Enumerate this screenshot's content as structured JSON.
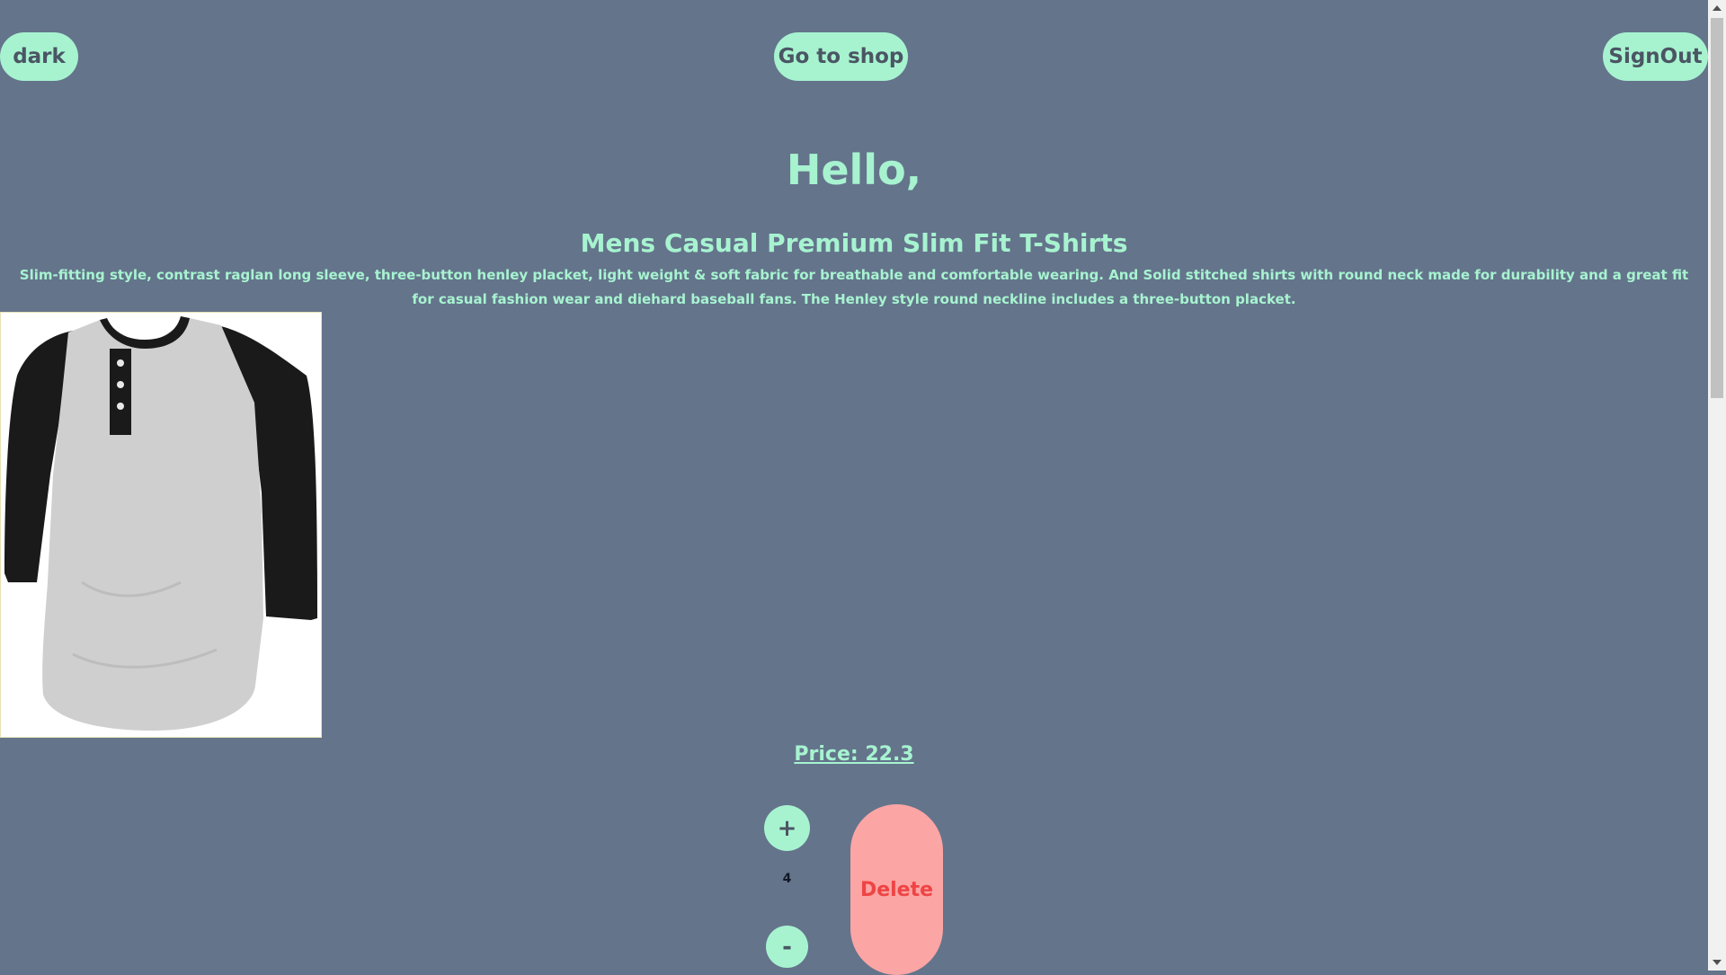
{
  "header": {
    "theme_toggle_label": "dark",
    "shop_label": "Go to shop",
    "signout_label": "SignOut"
  },
  "greeting": "Hello,",
  "product": {
    "title": "Mens Casual Premium Slim Fit T-Shirts",
    "description": "Slim-fitting style, contrast raglan long sleeve, three-button henley placket, light weight & soft fabric for breathable and comfortable wearing. And Solid stitched shirts with round neck made for durability and a great fit for casual fashion wear and diehard baseball fans. The Henley style round neckline includes a three-button placket.",
    "price_text": "Price: 22.3",
    "quantity": "4"
  },
  "controls": {
    "increment_label": "+",
    "decrement_label": "-",
    "delete_label": "Delete"
  },
  "colors": {
    "background": "#64748b",
    "accent": "#a7f3d0",
    "delete_bg": "#fca5a5",
    "delete_text": "#ef4444"
  },
  "icons": {
    "scroll_up": "scroll-up-arrow-icon",
    "scroll_down": "scroll-down-arrow-icon"
  }
}
